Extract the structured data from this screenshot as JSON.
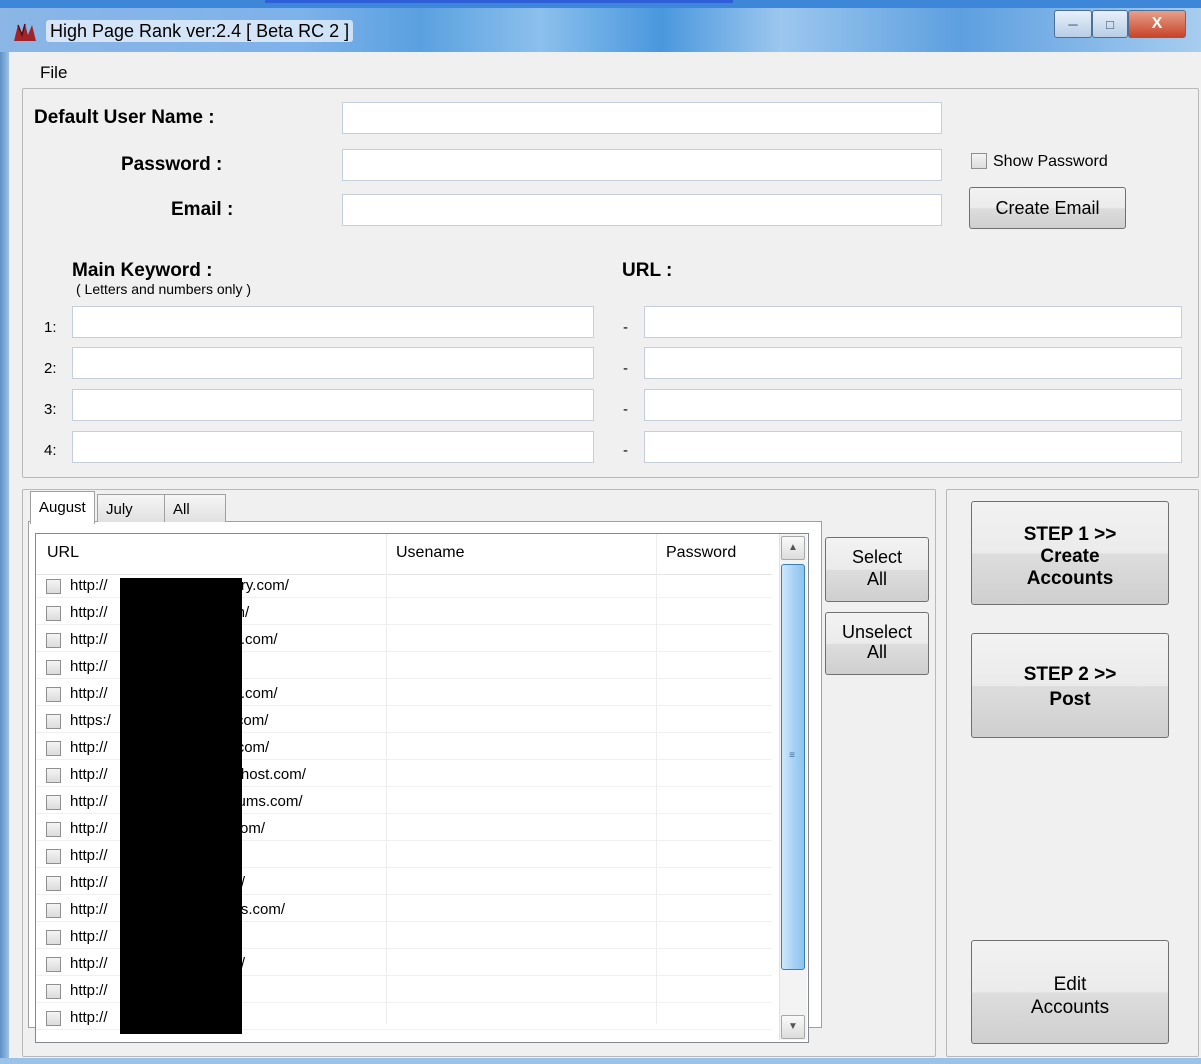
{
  "window": {
    "title": "High Page Rank ver:2.4  [ Beta RC 2 ]",
    "controls": {
      "minimize": "─",
      "maximize": "□",
      "close": "X"
    }
  },
  "menu": {
    "file": "File"
  },
  "account": {
    "username_label": "Default User Name :",
    "username_value": "",
    "password_label": "Password  :",
    "password_value": "",
    "show_password_label": "Show Password",
    "show_password_checked": false,
    "email_label": "Email :",
    "email_value": "",
    "create_email_label": "Create Email"
  },
  "keywords": {
    "main_keyword_label": "Main Keyword :",
    "hint": "( Letters and numbers only )",
    "url_label": "URL :",
    "rows": [
      {
        "num": "1:",
        "keyword": "",
        "url": "",
        "sep": "-"
      },
      {
        "num": "2:",
        "keyword": "",
        "url": "",
        "sep": "-"
      },
      {
        "num": "3:",
        "keyword": "",
        "url": "",
        "sep": "-"
      },
      {
        "num": "4:",
        "keyword": "",
        "url": "",
        "sep": "-"
      }
    ]
  },
  "tabs": [
    "August",
    "July",
    "All"
  ],
  "active_tab": "August",
  "list": {
    "columns": {
      "url": "URL",
      "username": "Usename",
      "password": "Password"
    },
    "rows": [
      {
        "url": "http://                              ary.com/",
        "checked": false
      },
      {
        "url": "http://                              m/",
        "checked": false
      },
      {
        "url": "http://                              e.com/",
        "checked": false
      },
      {
        "url": "http://                              /",
        "checked": false
      },
      {
        "url": "http://                              e.com/",
        "checked": false
      },
      {
        "url": "https:/                              com/",
        "checked": false
      },
      {
        "url": "http://                              .com/",
        "checked": false
      },
      {
        "url": "http://                              nhost.com/",
        "checked": false
      },
      {
        "url": "http://                              rums.com/",
        "checked": false
      },
      {
        "url": "http://                              com/",
        "checked": false
      },
      {
        "url": "http://",
        "checked": false
      },
      {
        "url": "http://                              n/",
        "checked": false
      },
      {
        "url": "http://                              ds.com/",
        "checked": false
      },
      {
        "url": "http://",
        "checked": false
      },
      {
        "url": "http://                              n/",
        "checked": false
      },
      {
        "url": "http://                              /",
        "checked": false
      },
      {
        "url": "http://",
        "checked": false
      }
    ]
  },
  "list_buttons": {
    "select_all": "Select All",
    "unselect_all": "Unselect All"
  },
  "steps": {
    "step1_line1": "STEP 1 >>",
    "step1_line2": "Create",
    "step1_line3": "Accounts",
    "step2_line1": "STEP 2 >>",
    "step2_line2": "Post",
    "edit_line1": "Edit",
    "edit_line2": "Accounts"
  },
  "scroll": {
    "up": "▲",
    "down": "▼",
    "grip": "≡"
  }
}
